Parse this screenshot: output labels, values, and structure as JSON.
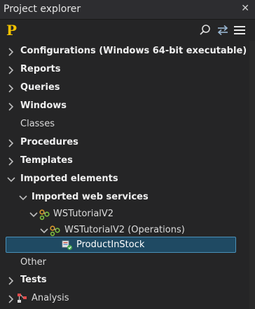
{
  "panel": {
    "title": "Project explorer",
    "close_glyph": "✕"
  },
  "toolbar": {
    "logo_letter": "P",
    "icons": [
      "search-icon",
      "sync-icon",
      "menu-icon"
    ]
  },
  "tree": {
    "items": [
      {
        "label": "Configurations (Windows 64-bit executable)"
      },
      {
        "label": "Reports"
      },
      {
        "label": "Queries"
      },
      {
        "label": "Windows"
      },
      {
        "label": "Classes"
      },
      {
        "label": "Procedures"
      },
      {
        "label": "Templates"
      },
      {
        "label": "Imported elements"
      },
      {
        "label": "Imported web services"
      },
      {
        "label": "WSTutorialV2"
      },
      {
        "label": "WSTutorialV2 (Operations)"
      },
      {
        "label": "ProductInStock"
      },
      {
        "label": "Other"
      },
      {
        "label": "Tests"
      },
      {
        "label": "Analysis"
      }
    ]
  },
  "colors": {
    "background": "#252526",
    "selection": "#1f4a63",
    "selection_border": "#4a90b8",
    "logo": "#f2c200"
  }
}
